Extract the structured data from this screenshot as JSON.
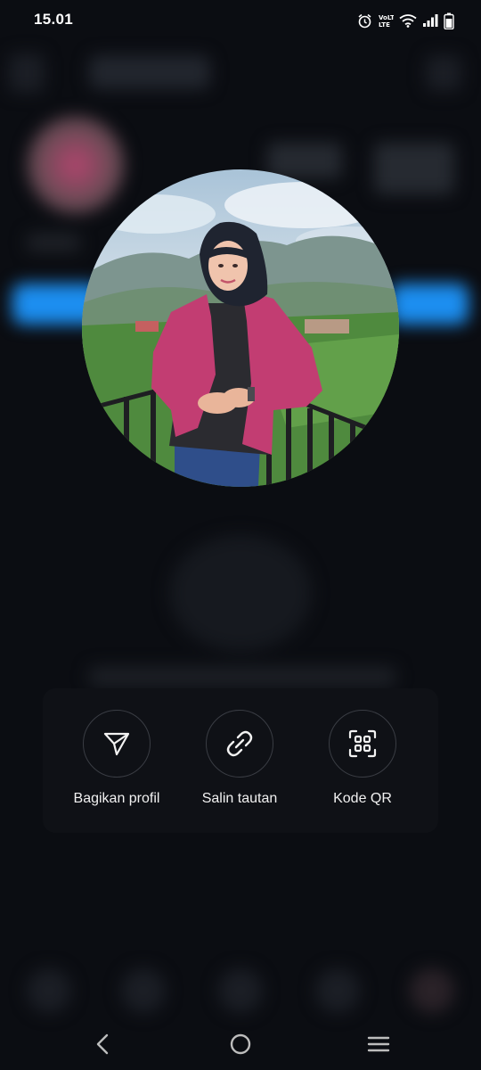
{
  "status_bar": {
    "time": "15.01",
    "icons": [
      "alarm-icon",
      "volte-lte-icon",
      "wifi-icon",
      "signal-icon",
      "battery-icon"
    ]
  },
  "avatar": {
    "description_icon": "profile-photo"
  },
  "share_actions": [
    {
      "label": "Bagikan profil",
      "icon": "send-icon"
    },
    {
      "label": "Salin tautan",
      "icon": "link-icon"
    },
    {
      "label": "Kode QR",
      "icon": "qr-code-icon"
    }
  ],
  "nav_bar": {
    "icons": [
      "back-icon",
      "home-icon",
      "recents-icon"
    ]
  },
  "colors": {
    "background": "#0b0d12",
    "sheet": "#0f1116",
    "accent_blue": "#1c8ef0",
    "text": "#f1f1f1"
  }
}
